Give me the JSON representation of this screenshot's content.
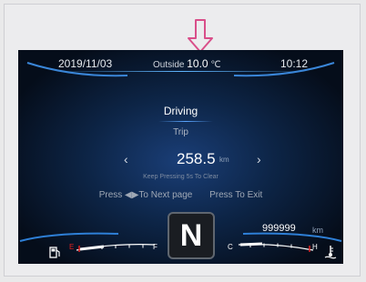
{
  "top_bar": {
    "date": "2019/11/03",
    "outside_label": "Outside",
    "outside_temp": "10.0",
    "temp_unit": "℃",
    "time": "10:12"
  },
  "main": {
    "mode_title": "Driving",
    "subtitle": "Trip",
    "trip_value": "258.5",
    "trip_unit": "km",
    "prev_arrow": "‹",
    "next_arrow": "›",
    "clear_hint": "Keep Pressing  5s To Clear",
    "next_page_instruction": "Press ◀▶To Next page",
    "exit_instruction": "Press To Exit"
  },
  "bottom": {
    "gear": "N",
    "odometer": "999999",
    "odometer_unit": "km",
    "fuel_empty_label": "E",
    "fuel_full_label": "F",
    "temp_cold_label": "C",
    "temp_hot_label": "H"
  },
  "icons": {
    "indicator": "down-arrow-icon",
    "fuel": "fuel-pump-icon",
    "coolant": "coolant-temperature-icon"
  },
  "colors": {
    "accent_line": "#5fb6ff",
    "warning_red": "#e02020",
    "indicator_pink": "#d94f8a"
  }
}
